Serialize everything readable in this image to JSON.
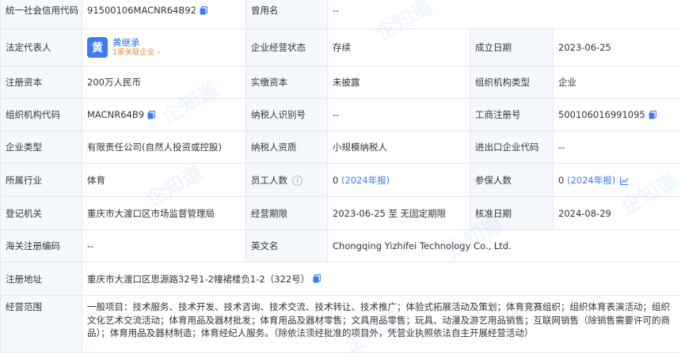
{
  "rows": {
    "r1": {
      "l1": "统一社会信用代码",
      "v1": "91500106MACNR64B92",
      "l2": "曾用名",
      "v2": "--"
    },
    "r2": {
      "l1": "法定代表人",
      "avatar": "黄",
      "rep_name": "黄继承",
      "rep_sub": "1家关联企业 ›",
      "l2": "企业经营状态",
      "v2": "存续",
      "l3": "成立日期",
      "v3": "2023-06-25"
    },
    "r3": {
      "l1": "注册资本",
      "v1": "200万人民币",
      "l2": "实缴资本",
      "v2": "未披露",
      "l3": "组织机构类型",
      "v3": "企业"
    },
    "r4": {
      "l1": "组织机构代码",
      "v1": "MACNR64B9",
      "l2": "纳税人识别号",
      "v2": "--",
      "l3": "工商注册号",
      "v3": "500106016991095"
    },
    "r5": {
      "l1": "企业类型",
      "v1": "有限责任公司(自然人投资或控股)",
      "l2": "纳税人资质",
      "v2": "小规模纳税人",
      "l3": "进出口企业代码",
      "v3": "--"
    },
    "r6": {
      "l1": "所属行业",
      "v1": "体育",
      "l2": "员工人数",
      "v2_num": "0",
      "v2_year": "(2024年报)",
      "l3": "参保人数",
      "v3_num": "0",
      "v3_year": "(2024年报)"
    },
    "r7": {
      "l1": "登记机关",
      "v1": "重庆市大渡口区市场监督管理局",
      "l2": "经营期限",
      "v2": "2023-06-25 至 无固定期限",
      "l3": "核准日期",
      "v3": "2024-08-29"
    },
    "r8": {
      "l1": "海关注册编码",
      "v1": "--",
      "l2": "英文名",
      "v2": "Chongqing Yizhifei Technology Co., Ltd."
    },
    "r9": {
      "l1": "注册地址",
      "v1": "重庆市大渡口区思源路32号1-2幢裙楼负1-2（322号）"
    },
    "r10": {
      "l1": "经营范围",
      "v1": "一般项目：技术服务、技术开发、技术咨询、技术交流、技术转让、技术推广；体验式拓展活动及策划；体育竞赛组织；组织体育表演活动；组织文化艺术交流活动；体育用品及器材批发；体育用品及器材零售；文具用品零售；玩具、动漫及游艺用品销售；互联网销售（除销售需要许可的商品）；体育用品及器材制造；体育经纪人服务。（除依法须经批准的项目外，凭营业执照依法自主开展经营活动）"
    }
  },
  "icons": {
    "copy": "copy-icon",
    "help": "help-circle-icon",
    "trend": "trend-chart-icon"
  },
  "colors": {
    "label_bg": "#f5f8fd",
    "accent": "#3b7df0",
    "border": "#e4e8ef",
    "orange": "#f08c2c"
  },
  "watermark": "企知道"
}
